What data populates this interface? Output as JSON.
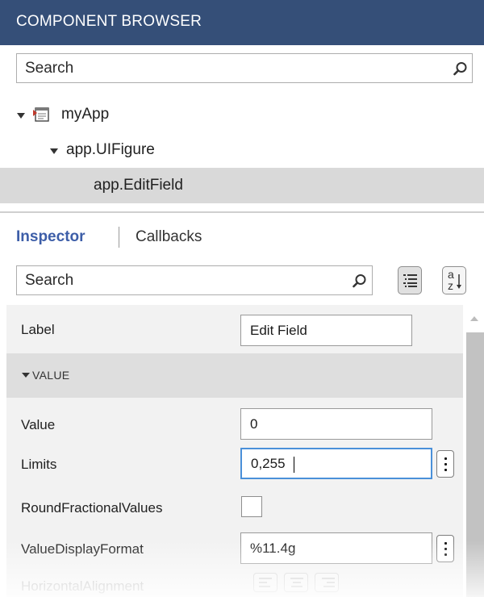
{
  "component_browser": {
    "title": "COMPONENT BROWSER",
    "search_placeholder": "Search",
    "tree": [
      {
        "label": "myApp",
        "expanded": true
      },
      {
        "label": "app.UIFigure",
        "expanded": true
      },
      {
        "label": "app.EditField",
        "selected": true
      }
    ]
  },
  "tabs": {
    "inspector": "Inspector",
    "callbacks": "Callbacks",
    "active": "Inspector"
  },
  "inspector": {
    "search_placeholder": "Search",
    "sort_buttons": {
      "grouped": "list-grouped-icon",
      "alphabetical": "sort-az-icon",
      "alphabetical_label_top": "a",
      "alphabetical_label_bottom": "z"
    },
    "properties": {
      "label": {
        "name": "Label",
        "value": "Edit Field"
      },
      "section": "VALUE",
      "value": {
        "name": "Value",
        "value": "0"
      },
      "limits": {
        "name": "Limits",
        "value": "0,255"
      },
      "round_fractional": {
        "name": "RoundFractionalValues",
        "checked": false
      },
      "display_format": {
        "name": "ValueDisplayFormat",
        "value": "%11.4g"
      },
      "horizontal_alignment": {
        "name": "HorizontalAlignment"
      }
    }
  },
  "colors": {
    "header_bg": "#354f78",
    "active_tab": "#3d5ea8",
    "selected_row": "#d9d9d9",
    "focus_border": "#4a90d9"
  }
}
